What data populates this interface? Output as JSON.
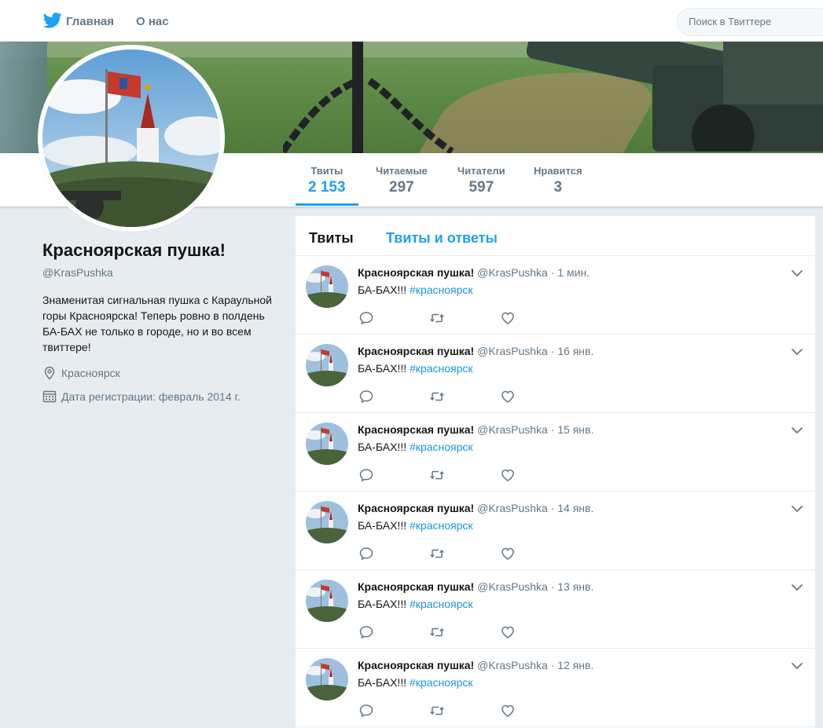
{
  "nav": {
    "home_label": "Главная",
    "about_label": "О нас",
    "search_placeholder": "Поиск в Твиттере"
  },
  "colors": {
    "accent": "#1da1f2",
    "link": "#1b95e0",
    "text_secondary": "#657786",
    "background": "#e6ecf0"
  },
  "stats": [
    {
      "label": "Твиты",
      "value": "2 153"
    },
    {
      "label": "Читаемые",
      "value": "297"
    },
    {
      "label": "Читатели",
      "value": "597"
    },
    {
      "label": "Нравится",
      "value": "3"
    }
  ],
  "profile": {
    "name": "Красноярская пушка!",
    "handle": "@KrasPushka",
    "bio": "Знаменитая сигнальная пушка с Караульной горы Красноярска! Теперь ровно в полдень БА-БАХ не только в городе, но и во всем твиттере!",
    "location": "Красноярск",
    "joined": "Дата регистрации: февраль 2014 г."
  },
  "timeline": {
    "tabs": [
      "Твиты",
      "Твиты и ответы"
    ],
    "tweets": [
      {
        "name": "Красноярская пушка!",
        "handle": "@KrasPushka",
        "sep": "·",
        "time": "1 мин.",
        "text": "БА-БАХ!!!",
        "hashtag": "#красноярск"
      },
      {
        "name": "Красноярская пушка!",
        "handle": "@KrasPushka",
        "sep": "·",
        "time": "16 янв.",
        "text": "БА-БАХ!!!",
        "hashtag": "#красноярск"
      },
      {
        "name": "Красноярская пушка!",
        "handle": "@KrasPushka",
        "sep": "·",
        "time": "15 янв.",
        "text": "БА-БАХ!!!",
        "hashtag": "#красноярск"
      },
      {
        "name": "Красноярская пушка!",
        "handle": "@KrasPushka",
        "sep": "·",
        "time": "14 янв.",
        "text": "БА-БАХ!!!",
        "hashtag": "#красноярск"
      },
      {
        "name": "Красноярская пушка!",
        "handle": "@KrasPushka",
        "sep": "·",
        "time": "13 янв.",
        "text": "БА-БАХ!!!",
        "hashtag": "#красноярск"
      },
      {
        "name": "Красноярская пушка!",
        "handle": "@KrasPushka",
        "sep": "·",
        "time": "12 янв.",
        "text": "БА-БАХ!!!",
        "hashtag": "#красноярск"
      }
    ],
    "icons": [
      "reply-icon",
      "retweet-icon",
      "like-icon",
      "chevron-down-icon"
    ]
  }
}
